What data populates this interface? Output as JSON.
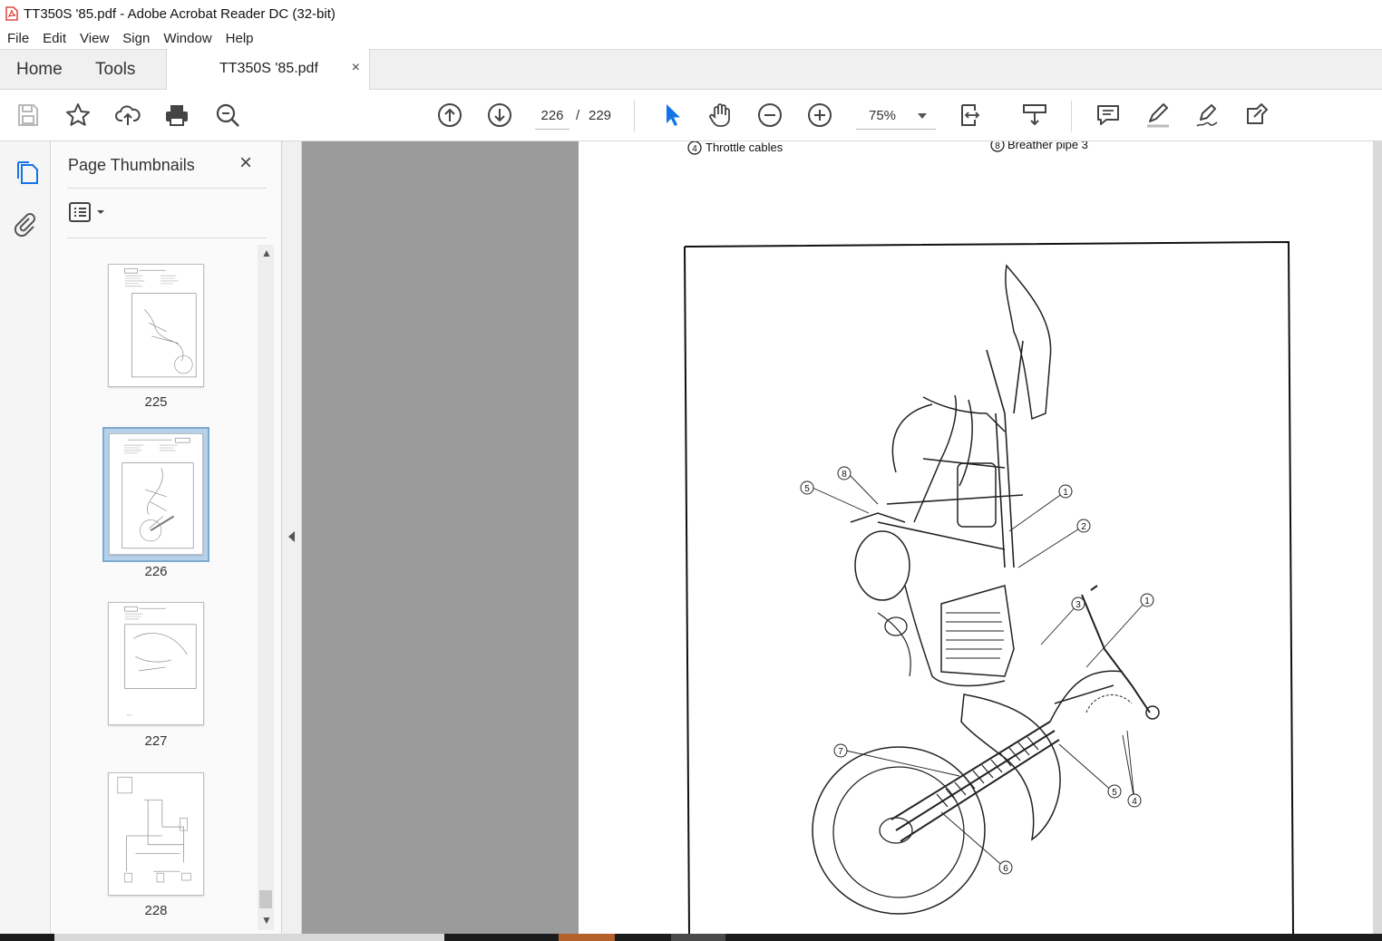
{
  "window": {
    "title": "TT350S '85.pdf - Adobe Acrobat Reader DC (32-bit)"
  },
  "menu": [
    "File",
    "Edit",
    "View",
    "Sign",
    "Window",
    "Help"
  ],
  "tabs": {
    "home": "Home",
    "tools": "Tools",
    "document": "TT350S '85.pdf",
    "close": "×"
  },
  "toolbar": {
    "page_current": "226",
    "page_sep": "/",
    "page_total": "229",
    "zoom": "75%",
    "accent": "#1473e6"
  },
  "panel": {
    "title": "Page Thumbnails",
    "close": "×",
    "thumbnails": [
      {
        "number": "225",
        "selected": false
      },
      {
        "number": "226",
        "selected": true
      },
      {
        "number": "227",
        "selected": false
      },
      {
        "number": "228",
        "selected": false
      }
    ]
  },
  "document": {
    "header_left_num": "4",
    "header_left": "Throttle cables",
    "header_right_num": "8",
    "header_right": "Breather pipe 3",
    "callouts": [
      "1",
      "2",
      "3",
      "1",
      "4",
      "5",
      "5",
      "6",
      "7",
      "8"
    ]
  }
}
